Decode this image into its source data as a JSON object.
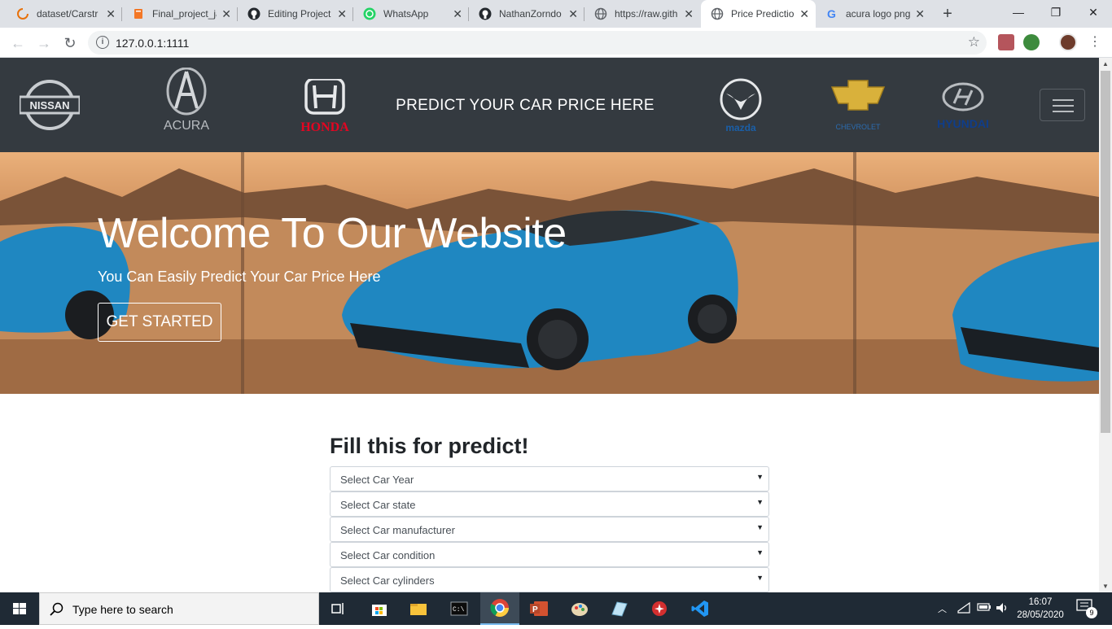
{
  "browser": {
    "tabs": [
      {
        "title": "dataset/Carstr",
        "icon": "loading-icon",
        "color": "#e8710a"
      },
      {
        "title": "Final_project_ja",
        "icon": "notebook-icon",
        "color": "#f37726"
      },
      {
        "title": "Editing Project",
        "icon": "github-icon",
        "color": "#24292e"
      },
      {
        "title": "WhatsApp",
        "icon": "whatsapp-icon",
        "color": "#25d366"
      },
      {
        "title": "NathanZorndo",
        "icon": "github-icon",
        "color": "#24292e"
      },
      {
        "title": "https://raw.gith",
        "icon": "globe-icon",
        "color": "#5f6368"
      },
      {
        "title": "Price Predictio",
        "icon": "globe-icon",
        "color": "#5f6368"
      },
      {
        "title": "acura logo png",
        "icon": "google-icon",
        "color": "#4285f4"
      }
    ],
    "url": "127.0.0.1:1111"
  },
  "navbar": {
    "title": "PREDICT YOUR CAR PRICE HERE",
    "brands": [
      {
        "name": "NISSAN"
      },
      {
        "name": "ACURA"
      },
      {
        "name": "HONDA",
        "color": "#e40521"
      },
      {
        "name": "mazda",
        "color": "#1a5fa8"
      },
      {
        "name": "CHEVROLET",
        "color": "#2b6cb0"
      },
      {
        "name": "HYUNDAI",
        "color": "#0f3d8a"
      }
    ]
  },
  "hero": {
    "heading": "Welcome To Our Website",
    "subheading": "You Can Easily Predict Your Car Price Here",
    "cta": "GET STARTED"
  },
  "form": {
    "title": "Fill this for predict!",
    "fields": [
      "Select Car Year",
      "Select Car state",
      "Select Car manufacturer",
      "Select Car condition",
      "Select Car cylinders"
    ]
  },
  "taskbar": {
    "search_placeholder": "Type here to search",
    "time": "16:07",
    "date": "28/05/2020",
    "notifications": "9"
  }
}
